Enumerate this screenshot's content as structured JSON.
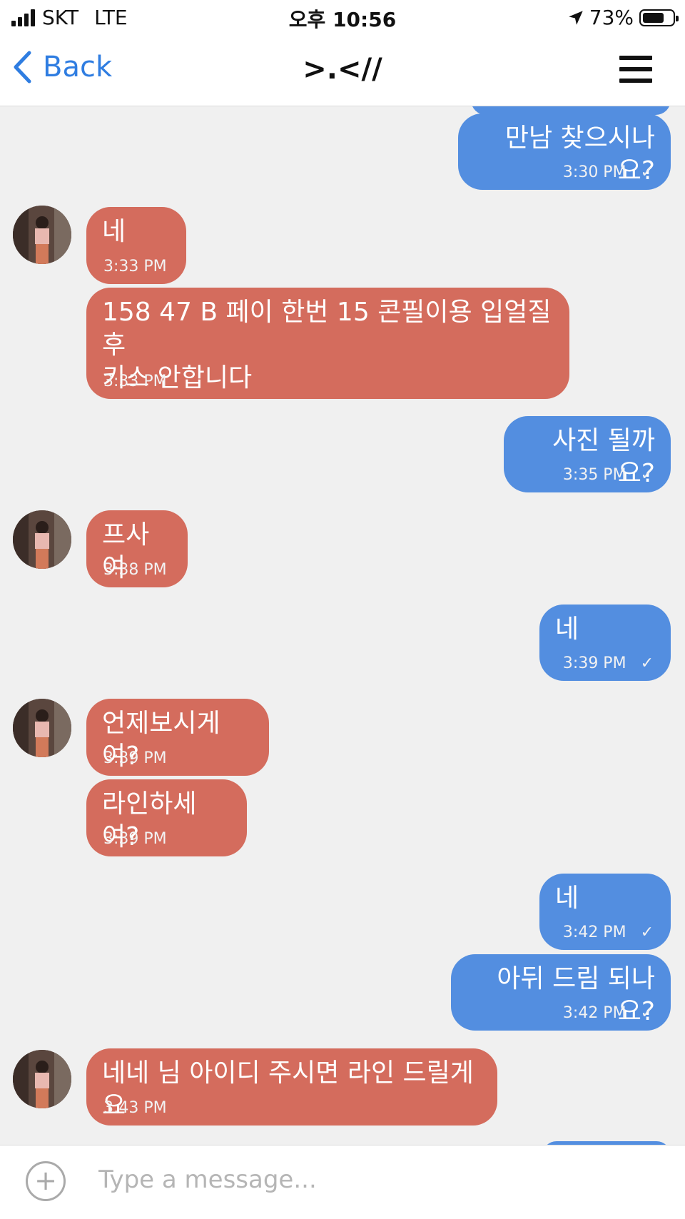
{
  "status_bar": {
    "carrier": "SKT",
    "network": "LTE",
    "time": "오후 10:56",
    "battery": "73%",
    "battery_level": 0.73
  },
  "nav": {
    "back_label": "Back",
    "title": ">.<//"
  },
  "messages": [
    {
      "dir": "out",
      "text": "만남 찾으시나요?",
      "time": "3:30 PM",
      "check": "✓"
    },
    {
      "dir": "in",
      "text": "네",
      "time": "3:33 PM"
    },
    {
      "dir": "in",
      "text": "158 47 B 페이 한번 15 콘필이용 입얼질후\n키스 안합니다",
      "time": "3:33 PM"
    },
    {
      "dir": "out",
      "text": "사진 될까요?",
      "time": "3:35 PM",
      "check": "✓"
    },
    {
      "dir": "in",
      "text": "프사여",
      "time": "3:38 PM"
    },
    {
      "dir": "out",
      "text": "네",
      "time": "3:39 PM",
      "check": "✓"
    },
    {
      "dir": "in",
      "text": "언제보시게여?",
      "time": "3:39 PM"
    },
    {
      "dir": "in",
      "text": "라인하세여?",
      "time": "3:39 PM"
    },
    {
      "dir": "out",
      "text": "네",
      "time": "3:42 PM",
      "check": "✓"
    },
    {
      "dir": "out",
      "text": "아뒤 드림 되나요?",
      "time": "3:42 PM",
      "check": "✓"
    },
    {
      "dir": "in",
      "text": "네네 님 아이디 주시면 라인 드릴게요",
      "time": "3:43 PM"
    }
  ],
  "input": {
    "placeholder": "Type a message..."
  },
  "icons": {
    "signal": "signal-bars-icon",
    "location": "location-arrow-icon",
    "battery": "battery-icon",
    "back": "chevron-left-icon",
    "menu": "hamburger-menu-icon",
    "attach": "plus-circle-icon"
  },
  "colors": {
    "incoming_bubble": "#d46c5d",
    "outgoing_bubble": "#538ee0",
    "accent": "#2f7de1",
    "background": "#f0f0f0"
  }
}
